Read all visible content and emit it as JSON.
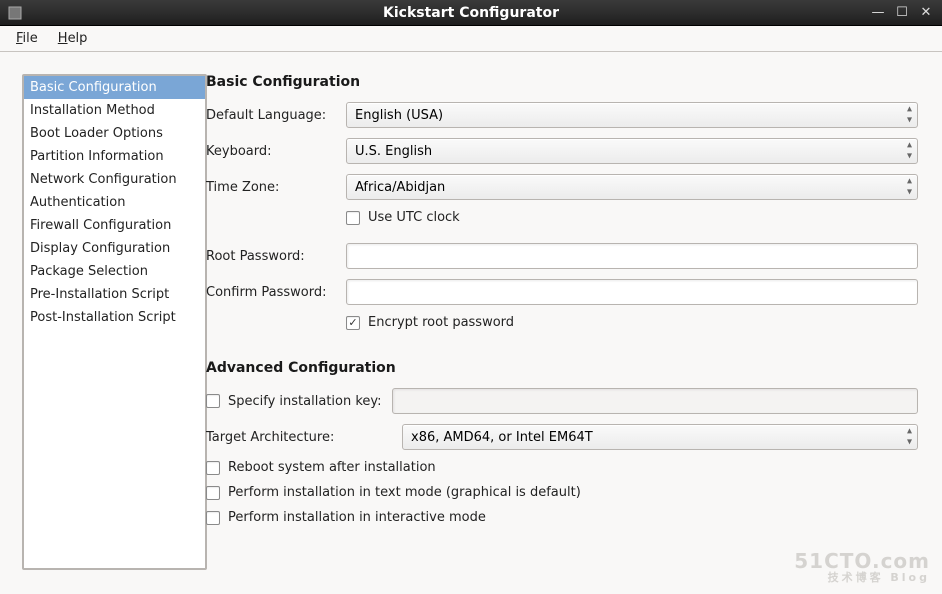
{
  "window": {
    "title": "Kickstart Configurator"
  },
  "menubar": {
    "file": "File",
    "help": "Help"
  },
  "sidebar": {
    "items": [
      "Basic Configuration",
      "Installation Method",
      "Boot Loader Options",
      "Partition Information",
      "Network Configuration",
      "Authentication",
      "Firewall Configuration",
      "Display Configuration",
      "Package Selection",
      "Pre-Installation Script",
      "Post-Installation Script"
    ]
  },
  "basic": {
    "title": "Basic Configuration",
    "default_language_label": "Default Language:",
    "default_language_value": "English (USA)",
    "keyboard_label": "Keyboard:",
    "keyboard_value": "U.S. English",
    "timezone_label": "Time Zone:",
    "timezone_value": "Africa/Abidjan",
    "use_utc_label": "Use UTC clock",
    "root_password_label": "Root Password:",
    "root_password_value": "",
    "confirm_password_label": "Confirm Password:",
    "confirm_password_value": "",
    "encrypt_root_label": "Encrypt root password"
  },
  "advanced": {
    "title": "Advanced Configuration",
    "specify_key_label": "Specify installation key:",
    "specify_key_value": "",
    "target_arch_label": "Target Architecture:",
    "target_arch_value": "x86, AMD64, or Intel EM64T",
    "reboot_label": "Reboot system after installation",
    "text_mode_label": "Perform installation in text mode (graphical is default)",
    "interactive_label": "Perform installation in interactive mode"
  },
  "watermark": {
    "line1": "51CTO.com",
    "line2": "技术博客  Blog"
  }
}
